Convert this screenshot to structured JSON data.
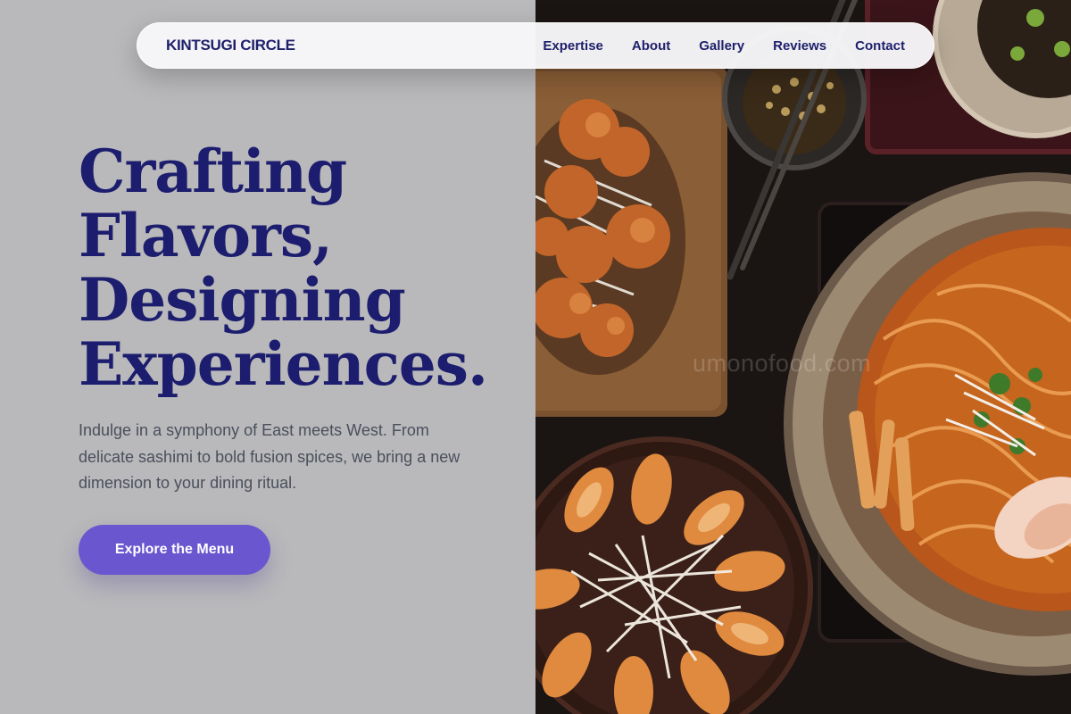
{
  "nav": {
    "brand": "KINTSUGI CIRCLE",
    "links": [
      "Expertise",
      "About",
      "Gallery",
      "Reviews",
      "Contact"
    ]
  },
  "hero": {
    "title_lines": [
      "Crafting",
      "Flavors,",
      "Designing",
      "Experiences."
    ],
    "description": "Indulge in a symphony of East meets West. From delicate sashimi to bold fusion spices, we bring a new dimension to your dining ritual.",
    "cta_label": "Explore the Menu"
  },
  "image": {
    "watermark": "umonofood.com",
    "icon": "food-photo"
  },
  "colors": {
    "background": "#b9b9bb",
    "heading": "#1c1d6e",
    "nav_text": "#1e1f6b",
    "body_text": "#4a4f5c",
    "accent": "#6a56cf",
    "navbar_bg": "#f8f8fa"
  }
}
